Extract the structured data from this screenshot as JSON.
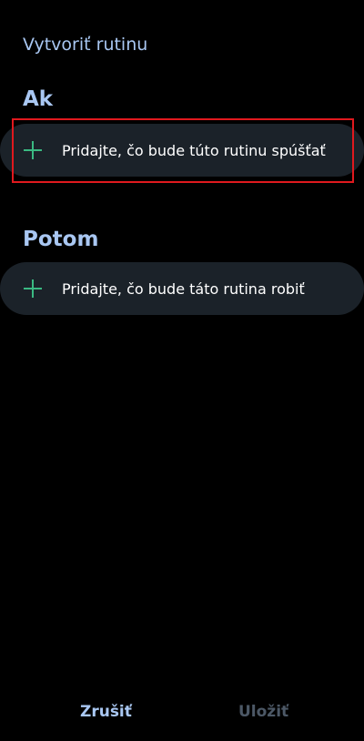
{
  "header": {
    "title": "Vytvoriť rutinu"
  },
  "if_section": {
    "title": "Ak",
    "add_trigger_label": "Pridajte, čo bude túto rutinu spúšťať",
    "icon": "plus-icon"
  },
  "then_section": {
    "title": "Potom",
    "add_action_label": "Pridajte, čo bude táto rutina robiť",
    "icon": "plus-icon"
  },
  "footer": {
    "cancel_label": "Zrušiť",
    "save_label": "Uložiť"
  },
  "colors": {
    "background": "#000000",
    "accent_text": "#a9c7f2",
    "row_background": "#1b2229",
    "plus": "#3ab982",
    "highlight": "#e0191e",
    "disabled_text": "#4c5866"
  }
}
